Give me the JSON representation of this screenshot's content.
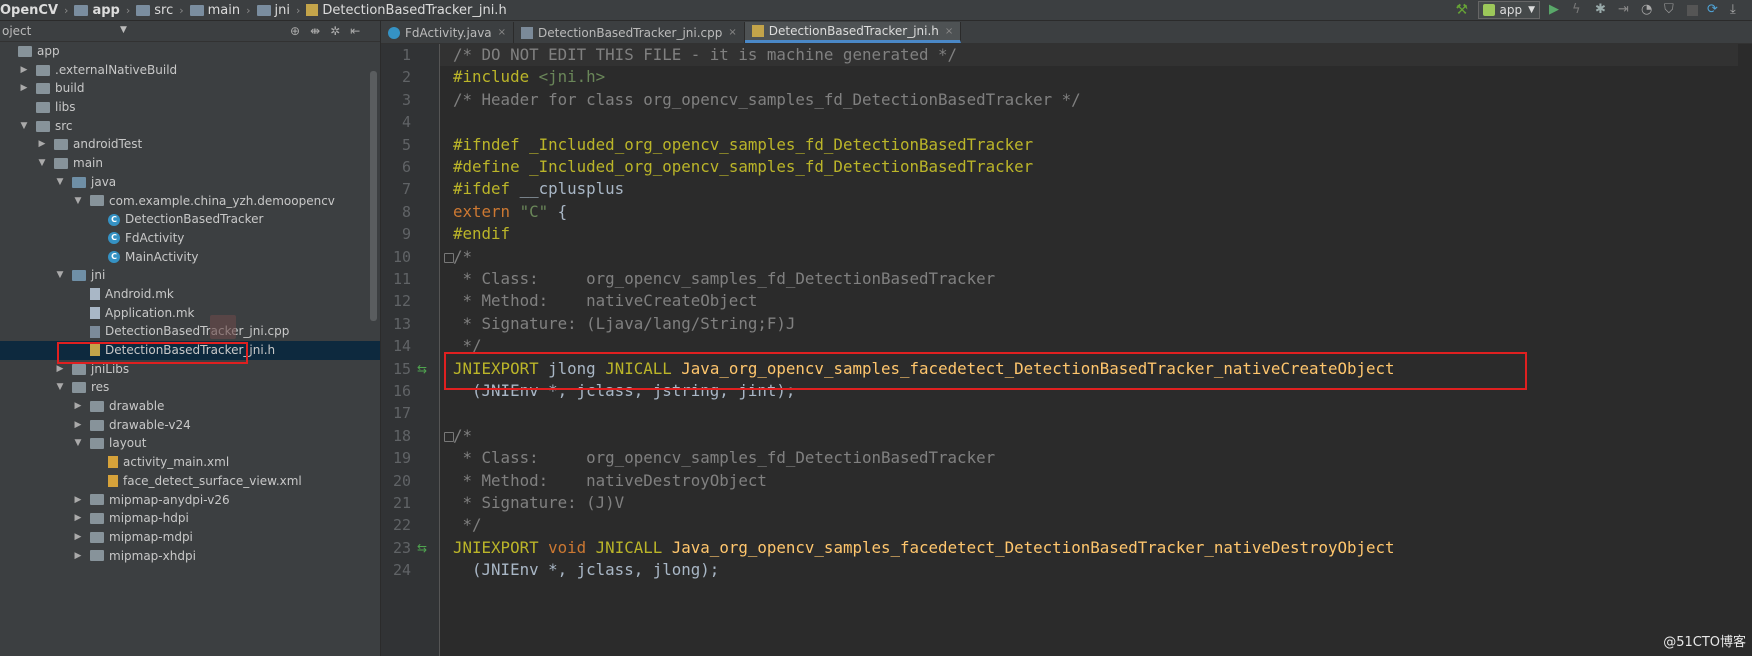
{
  "breadcrumb": [
    "OpenCV",
    "app",
    "src",
    "main",
    "jni",
    "DetectionBasedTracker_jni.h"
  ],
  "toolbar": {
    "run_config": "app",
    "accent": "#9cc85a",
    "icons": [
      "build-hammer-icon",
      "run-icon",
      "apply-changes-icon",
      "debug-icon",
      "attach-debugger-icon",
      "profile-icon",
      "coverage-icon",
      "stop-icon",
      "sync-icon",
      "sdk-manager-icon"
    ]
  },
  "project_panel": {
    "header": "oject",
    "tree": [
      {
        "label": "app",
        "indent": 0,
        "arrow": "",
        "icon": "folder"
      },
      {
        "label": ".externalNativeBuild",
        "indent": 1,
        "arrow": "right",
        "icon": "folder"
      },
      {
        "label": "build",
        "indent": 1,
        "arrow": "right",
        "icon": "folder"
      },
      {
        "label": "libs",
        "indent": 1,
        "arrow": "",
        "icon": "folder"
      },
      {
        "label": "src",
        "indent": 1,
        "arrow": "down",
        "icon": "folder"
      },
      {
        "label": "androidTest",
        "indent": 2,
        "arrow": "right",
        "icon": "folder"
      },
      {
        "label": "main",
        "indent": 2,
        "arrow": "down",
        "icon": "folder"
      },
      {
        "label": "java",
        "indent": 3,
        "arrow": "down",
        "icon": "src"
      },
      {
        "label": "com.example.china_yzh.demoopencv",
        "indent": 4,
        "arrow": "down",
        "icon": "pkg"
      },
      {
        "label": "DetectionBasedTracker",
        "indent": 5,
        "arrow": "",
        "icon": "class"
      },
      {
        "label": "FdActivity",
        "indent": 5,
        "arrow": "",
        "icon": "class"
      },
      {
        "label": "MainActivity",
        "indent": 5,
        "arrow": "",
        "icon": "class"
      },
      {
        "label": "jni",
        "indent": 3,
        "arrow": "down",
        "icon": "src"
      },
      {
        "label": "Android.mk",
        "indent": 4,
        "arrow": "",
        "icon": "file"
      },
      {
        "label": "Application.mk",
        "indent": 4,
        "arrow": "",
        "icon": "file"
      },
      {
        "label": "DetectionBasedTracker_jni.cpp",
        "indent": 4,
        "arrow": "",
        "icon": "cpp"
      },
      {
        "label": "DetectionBasedTracker_jni.h",
        "indent": 4,
        "arrow": "",
        "icon": "h",
        "selected": true
      },
      {
        "label": "jniLibs",
        "indent": 3,
        "arrow": "right",
        "icon": "folder"
      },
      {
        "label": "res",
        "indent": 3,
        "arrow": "down",
        "icon": "folder"
      },
      {
        "label": "drawable",
        "indent": 4,
        "arrow": "right",
        "icon": "folder"
      },
      {
        "label": "drawable-v24",
        "indent": 4,
        "arrow": "right",
        "icon": "folder"
      },
      {
        "label": "layout",
        "indent": 4,
        "arrow": "down",
        "icon": "folder"
      },
      {
        "label": "activity_main.xml",
        "indent": 5,
        "arrow": "",
        "icon": "xml"
      },
      {
        "label": "face_detect_surface_view.xml",
        "indent": 5,
        "arrow": "",
        "icon": "xml"
      },
      {
        "label": "mipmap-anydpi-v26",
        "indent": 4,
        "arrow": "right",
        "icon": "folder"
      },
      {
        "label": "mipmap-hdpi",
        "indent": 4,
        "arrow": "right",
        "icon": "folder"
      },
      {
        "label": "mipmap-mdpi",
        "indent": 4,
        "arrow": "right",
        "icon": "folder"
      },
      {
        "label": "mipmap-xhdpi",
        "indent": 4,
        "arrow": "right",
        "icon": "folder"
      }
    ]
  },
  "tabs": [
    {
      "label": "FdActivity.java",
      "icon": "java",
      "active": false
    },
    {
      "label": "DetectionBasedTracker_jni.cpp",
      "icon": "cpp",
      "active": false
    },
    {
      "label": "DetectionBasedTracker_jni.h",
      "icon": "h",
      "active": true
    }
  ],
  "editor": {
    "lines": [
      {
        "n": "1",
        "tokens": [
          [
            "c-com",
            "/* DO NOT EDIT THIS FILE - it is machine generated */"
          ]
        ]
      },
      {
        "n": "2",
        "tokens": [
          [
            "c-macro",
            "#include "
          ],
          [
            "c-str",
            "<jni.h>"
          ]
        ]
      },
      {
        "n": "3",
        "tokens": [
          [
            "c-com",
            "/* Header for class org_opencv_samples_fd_DetectionBasedTracker */"
          ]
        ]
      },
      {
        "n": "4",
        "tokens": []
      },
      {
        "n": "5",
        "tokens": [
          [
            "c-macro",
            "#ifndef "
          ],
          [
            "c-macro",
            "_Included_org_opencv_samples_fd_DetectionBasedTracker"
          ]
        ]
      },
      {
        "n": "6",
        "tokens": [
          [
            "c-macro",
            "#define "
          ],
          [
            "c-macro",
            "_Included_org_opencv_samples_fd_DetectionBasedTracker"
          ]
        ]
      },
      {
        "n": "7",
        "tokens": [
          [
            "c-macro",
            "#ifdef "
          ],
          [
            "c-plain",
            "__cplusplus"
          ]
        ]
      },
      {
        "n": "8",
        "tokens": [
          [
            "c-kw",
            "extern "
          ],
          [
            "c-str",
            "\"C\""
          ],
          [
            "c-plain",
            " {"
          ]
        ]
      },
      {
        "n": "9",
        "tokens": [
          [
            "c-macro",
            "#endif"
          ]
        ]
      },
      {
        "n": "10",
        "tokens": [
          [
            "c-com",
            "/*"
          ]
        ],
        "fold": true
      },
      {
        "n": "11",
        "tokens": [
          [
            "c-com",
            " * Class:     org_opencv_samples_fd_DetectionBasedTracker"
          ]
        ]
      },
      {
        "n": "12",
        "tokens": [
          [
            "c-com",
            " * Method:    nativeCreateObject"
          ]
        ]
      },
      {
        "n": "13",
        "tokens": [
          [
            "c-com",
            " * Signature: (Ljava/lang/String;F)J"
          ]
        ]
      },
      {
        "n": "14",
        "tokens": [
          [
            "c-com",
            " */"
          ]
        ]
      },
      {
        "n": "15",
        "tokens": [
          [
            "c-macro",
            "JNIEXPORT "
          ],
          [
            "c-plain",
            "jlong "
          ],
          [
            "c-macro",
            "JNICALL "
          ],
          [
            "c-fn",
            "Java_org_opencv_samples_facedetect_DetectionBasedTracker_nativeCreateObject"
          ]
        ],
        "mark": true
      },
      {
        "n": "16",
        "tokens": [
          [
            "c-plain",
            "  (JNIEnv *, jclass, jstring, jint);"
          ]
        ]
      },
      {
        "n": "17",
        "tokens": []
      },
      {
        "n": "18",
        "tokens": [
          [
            "c-com",
            "/*"
          ]
        ],
        "fold": true
      },
      {
        "n": "19",
        "tokens": [
          [
            "c-com",
            " * Class:     org_opencv_samples_fd_DetectionBasedTracker"
          ]
        ]
      },
      {
        "n": "20",
        "tokens": [
          [
            "c-com",
            " * Method:    nativeDestroyObject"
          ]
        ]
      },
      {
        "n": "21",
        "tokens": [
          [
            "c-com",
            " * Signature: (J)V"
          ]
        ]
      },
      {
        "n": "22",
        "tokens": [
          [
            "c-com",
            " */"
          ]
        ]
      },
      {
        "n": "23",
        "tokens": [
          [
            "c-macro",
            "JNIEXPORT "
          ],
          [
            "c-kw",
            "void "
          ],
          [
            "c-macro",
            "JNICALL "
          ],
          [
            "c-fn",
            "Java_org_opencv_samples_facedetect_DetectionBasedTracker_nativeDestroyObject"
          ]
        ],
        "mark": true
      },
      {
        "n": "24",
        "tokens": [
          [
            "c-plain",
            "  (JNIEnv *, jclass, jlong);"
          ]
        ]
      }
    ]
  },
  "watermark": "@51CTO博客"
}
